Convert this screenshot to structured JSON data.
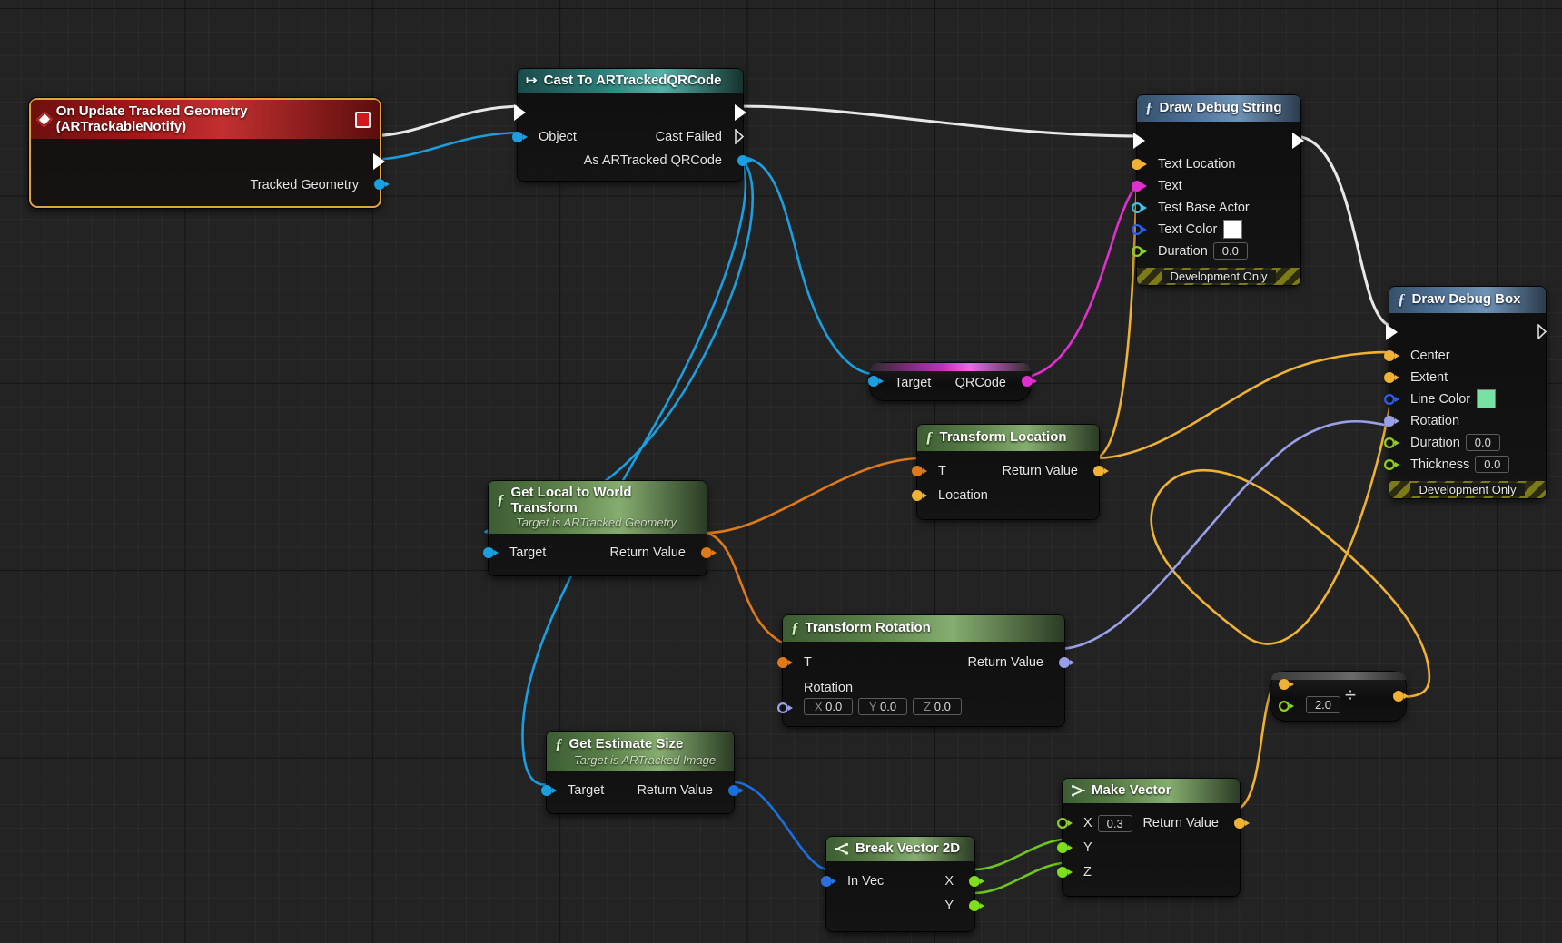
{
  "graph": {
    "title": "Unreal Engine Blueprint Event Graph",
    "background_color": "#232323"
  },
  "nodes": {
    "event_on_update": {
      "title": "On Update Tracked Geometry (ARTrackableNotify)",
      "outputs": {
        "exec": "",
        "tracked_geometry": "Tracked Geometry"
      }
    },
    "cast_qrcode": {
      "title": "Cast To ARTrackedQRCode",
      "input_object": "Object",
      "out_cast_failed": "Cast Failed",
      "out_as_qrcode": "As ARTracked QRCode"
    },
    "draw_debug_string": {
      "title": "Draw Debug String",
      "pins": {
        "text_location": "Text Location",
        "text": "Text",
        "test_base_actor": "Test Base Actor",
        "text_color": "Text Color",
        "text_color_value": "#ffffff",
        "duration": "Duration",
        "duration_value": "0.0"
      },
      "footer": "Development Only"
    },
    "draw_debug_box": {
      "title": "Draw Debug Box",
      "pins": {
        "center": "Center",
        "extent": "Extent",
        "line_color": "Line Color",
        "line_color_value": "#76e3a4",
        "rotation": "Rotation",
        "duration": "Duration",
        "duration_value": "0.0",
        "thickness": "Thickness",
        "thickness_value": "0.0"
      },
      "footer": "Development Only"
    },
    "qrcode_getter": {
      "input_target": "Target",
      "output_qrcode": "QRCode"
    },
    "transform_location": {
      "title": "Transform Location",
      "in_t": "T",
      "in_location": "Location",
      "out_return": "Return Value"
    },
    "get_local_to_world": {
      "title": "Get Local to World Transform",
      "subtitle": "Target is ARTracked Geometry",
      "in_target": "Target",
      "out_return": "Return Value"
    },
    "transform_rotation": {
      "title": "Transform Rotation",
      "in_t": "T",
      "in_rotation": "Rotation",
      "rotation_x_label": "X",
      "rotation_x_value": "0.0",
      "rotation_y_label": "Y",
      "rotation_y_value": "0.0",
      "rotation_z_label": "Z",
      "rotation_z_value": "0.0",
      "out_return": "Return Value"
    },
    "get_estimate_size": {
      "title": "Get Estimate Size",
      "subtitle": "Target is ARTracked Image",
      "in_target": "Target",
      "out_return": "Return Value"
    },
    "break_vector_2d": {
      "title": "Break Vector 2D",
      "in_vec": "In Vec",
      "out_x": "X",
      "out_y": "Y"
    },
    "make_vector": {
      "title": "Make Vector",
      "in_x": "X",
      "in_x_value": "0.3",
      "in_y": "Y",
      "in_z": "Z",
      "out_return": "Return Value"
    },
    "divide": {
      "operator": "÷",
      "in_b_value": "2.0"
    }
  }
}
